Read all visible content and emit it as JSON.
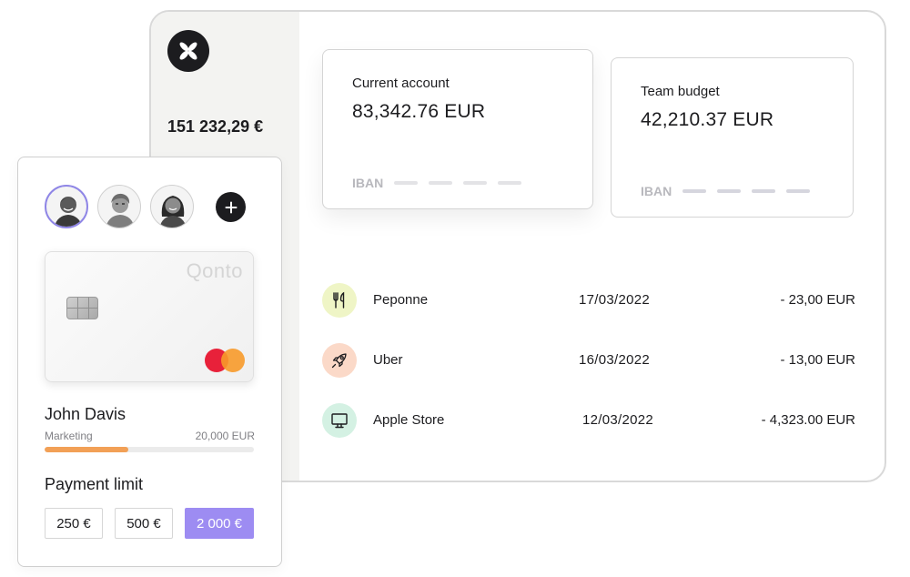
{
  "sidebar": {
    "balance": "151 232,29 €",
    "logo_icon": "qonto-cross-icon"
  },
  "accounts": [
    {
      "label": "Current account",
      "amount": "83,342.76 EUR",
      "iban_label": "IBAN"
    },
    {
      "label": "Team budget",
      "amount": "42,210.37 EUR",
      "iban_label": "IBAN"
    }
  ],
  "transactions": [
    {
      "name": "Peponne",
      "date": "17/03/2022",
      "amount": "- 23,00 EUR",
      "icon": "fork-knife-icon",
      "icon_bg": "#eff5c6"
    },
    {
      "name": "Uber",
      "date": "16/03/2022",
      "amount": "- 13,00 EUR",
      "icon": "rocket-icon",
      "icon_bg": "#fbd9c8"
    },
    {
      "name": "Apple Store",
      "date": "12/03/2022",
      "amount": "-  4,323.00 EUR",
      "icon": "monitor-icon",
      "icon_bg": "#d4f1e3"
    }
  ],
  "card_panel": {
    "card_brand": "Qonto",
    "holder_name": "John Davis",
    "department": "Marketing",
    "spending_limit": "20,000 EUR",
    "spending_progress": 0.4,
    "payment_limit_title": "Payment limit",
    "limit_options": [
      "250 €",
      "500 €",
      "2 000 €"
    ],
    "selected_limit": "2 000 €"
  },
  "colors": {
    "accent": "#9d8cf2",
    "progress": "#f2a056",
    "mastercard_red": "#e8213a",
    "mastercard_orange": "#f79a2a"
  }
}
